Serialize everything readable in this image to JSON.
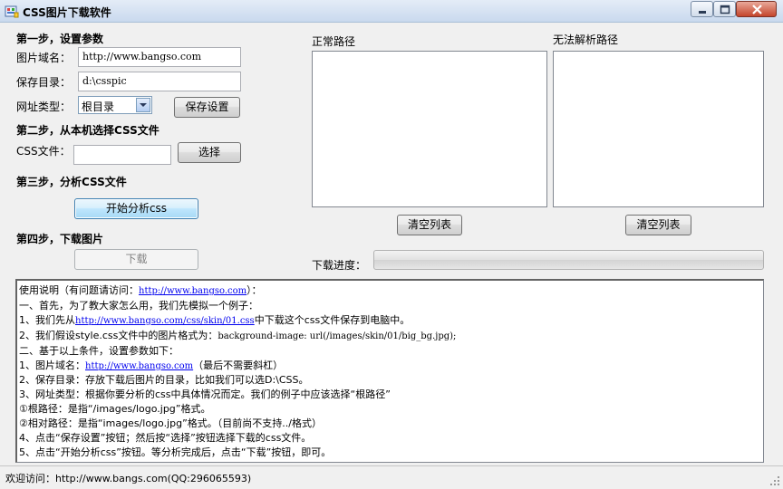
{
  "window": {
    "title": "CSS图片下载软件"
  },
  "step1": {
    "title": "第一步，设置参数",
    "domain_label": "图片域名：",
    "domain_value": "http://www.bangso.com",
    "savedir_label": "保存目录：",
    "savedir_value": "d:\\csspic",
    "urltype_label": "网址类型：",
    "urltype_value": "根目录",
    "save_button": "保存设置"
  },
  "step2": {
    "title": "第二步，从本机选择CSS文件",
    "file_label": "CSS文件：",
    "file_value": "",
    "select_button": "选择"
  },
  "step3": {
    "title": "第三步，分析CSS文件",
    "analyze_button": "开始分析css"
  },
  "step4": {
    "title": "第四步，下载图片",
    "download_button": "下载"
  },
  "lists": {
    "normal_label": "正常路径",
    "failed_label": "无法解析路径",
    "clear_normal_button": "清空列表",
    "clear_failed_button": "清空列表"
  },
  "progress": {
    "label": "下载进度：",
    "value": 0
  },
  "instructions": {
    "l1_pre": "使用说明（有问题请访问：",
    "l1_link": "http://www.bangso.com",
    "l1_post": "）：",
    "l2": "一、首先，为了教大家怎么用，我们先模拟一个例子：",
    "l3_pre": "1、我们先从",
    "l3_link": "http://www.bangso.com/css/skin/01.css",
    "l3_post": "中下载这个css文件保存到电脑中。",
    "l4_pre": "2、我们假设style.css文件中的图片格式为：",
    "l4_code": "background-image: url(/images/skin/01/big_bg.jpg);",
    "l5": "二、基于以上条件，设置参数如下：",
    "l6_pre": "1、图片域名：",
    "l6_link": "http://www.bangso.com",
    "l6_post": "（最后不需要斜杠）",
    "l7": "2、保存目录：存放下载后图片的目录，比如我们可以选D:\\CSS。",
    "l8": "3、网址类型：根据你要分析的css中具体情况而定。我们的例子中应该选择“根路径”",
    "l9": "①根路径：是指“/images/logo.jpg”格式。",
    "l10": "②相对路径：是指“images/logo.jpg”格式。（目前尚不支持../格式）",
    "l11": "4、点击“保存设置”按钮；然后按“选择”按钮选择下载的css文件。",
    "l12": "5、点击“开始分析css”按钮。等分析完成后，点击“下载”按钮，即可。"
  },
  "statusbar": {
    "text": "欢迎访问：http://www.bangs.com(QQ:296065593)"
  },
  "icons": [
    "app-icon",
    "minimize-icon",
    "maximize-icon",
    "close-icon",
    "chevron-down-icon",
    "size-grip-icon"
  ],
  "colors": {
    "titlebar": "#c9d9ee",
    "link": "#0000ee",
    "close_button": "#c4442b"
  }
}
